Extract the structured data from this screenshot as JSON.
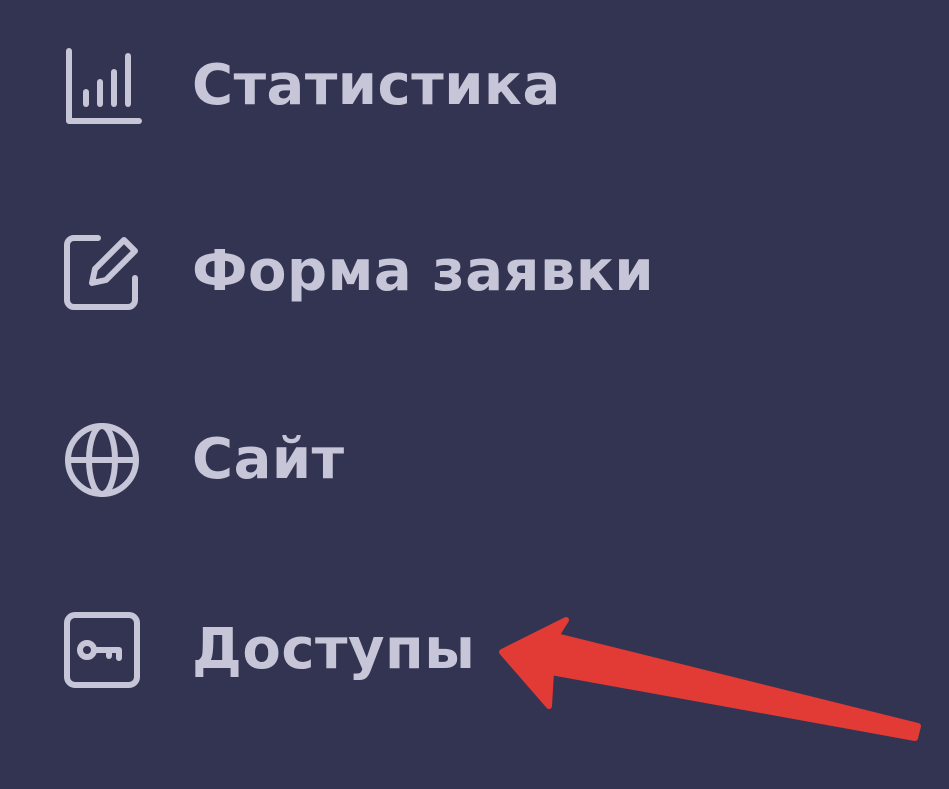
{
  "sidebar": {
    "items": [
      {
        "label": "Статистика",
        "icon": "bar-chart-icon"
      },
      {
        "label": "Форма заявки",
        "icon": "edit-form-icon"
      },
      {
        "label": "Сайт",
        "icon": "globe-icon"
      },
      {
        "label": "Доступы",
        "icon": "key-icon"
      }
    ]
  },
  "colors": {
    "background": "#333452",
    "text": "#c6c6d8",
    "icon": "#c6c6d8",
    "arrow": "#e23a35"
  }
}
